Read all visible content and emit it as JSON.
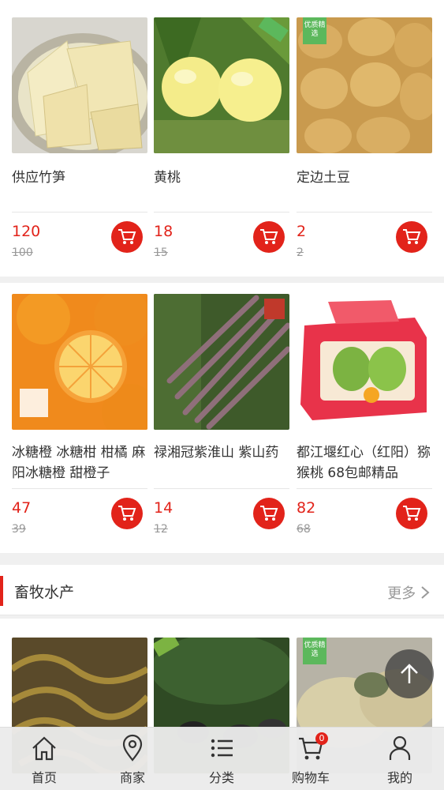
{
  "products_row1": [
    {
      "name": "供应竹笋",
      "price": "120",
      "old_price": "100"
    },
    {
      "name": "黄桃",
      "price": "18",
      "old_price": "15"
    },
    {
      "name": "定边土豆",
      "price": "2",
      "old_price": "2"
    }
  ],
  "products_row2": [
    {
      "name": "冰糖橙 冰糖柑 柑橘 麻阳冰糖橙 甜橙子",
      "price": "47",
      "old_price": "39"
    },
    {
      "name": "禄湘冠紫淮山 紫山药",
      "price": "14",
      "old_price": "12"
    },
    {
      "name": "都江堰红心（红阳）猕猴桃 68包邮精品",
      "price": "82",
      "old_price": "68"
    }
  ],
  "badges": {
    "premium": "优质精选"
  },
  "section": {
    "title": "畜牧水产",
    "more": "更多"
  },
  "tabbar": {
    "items": [
      {
        "label": "首页",
        "icon": "home-icon"
      },
      {
        "label": "商家",
        "icon": "location-pin-icon"
      },
      {
        "label": "分类",
        "icon": "list-icon"
      },
      {
        "label": "购物车",
        "icon": "cart-icon"
      },
      {
        "label": "我的",
        "icon": "user-icon"
      }
    ],
    "cart_count": "0"
  },
  "colors": {
    "accent": "#e2231a",
    "badge_green": "#5cb85c"
  }
}
